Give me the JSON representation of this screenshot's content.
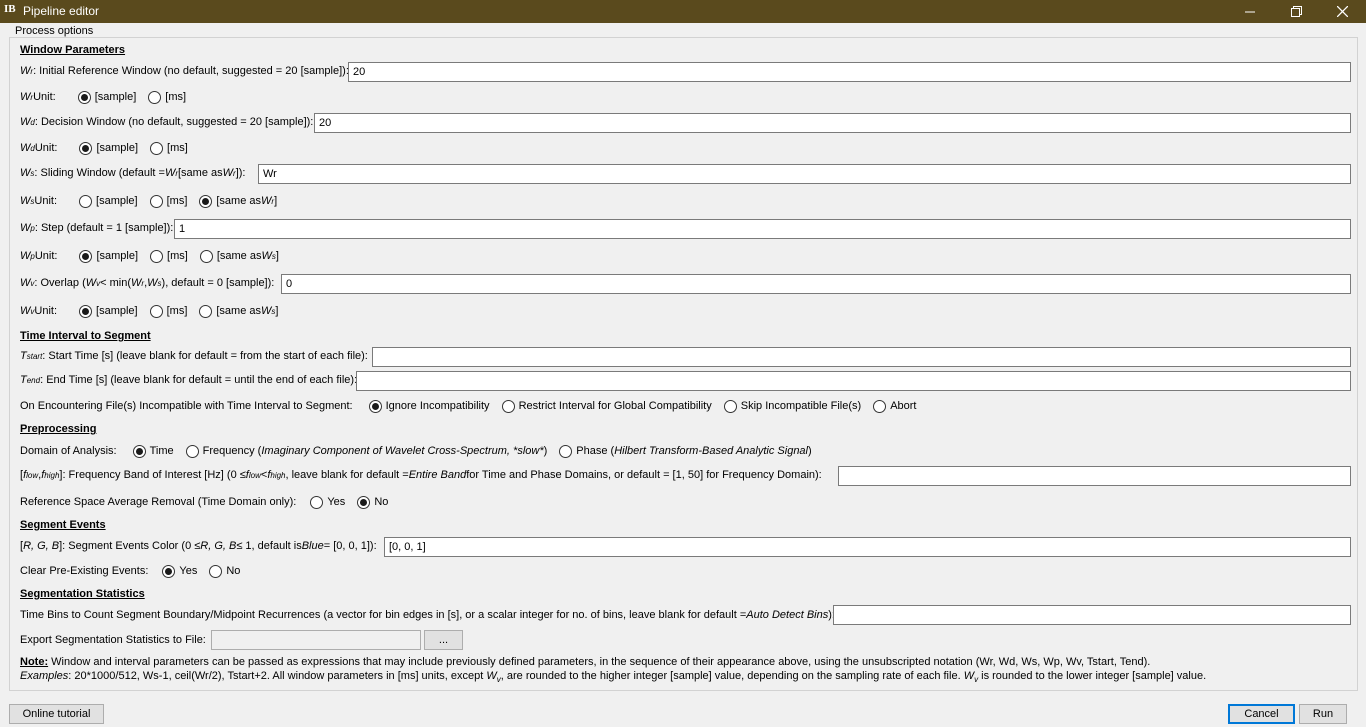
{
  "window": {
    "title": "Pipeline editor",
    "icon": "brainstorm-icon"
  },
  "panel": {
    "title": "Process options"
  },
  "sections": {
    "window_params": "Window Parameters",
    "time_interval": "Time Interval to Segment",
    "preprocessing": "Preprocessing",
    "segment_events": "Segment Events",
    "seg_stats": "Segmentation Statistics"
  },
  "wr": {
    "sym": "W",
    "sub": "r",
    "label": ": Initial Reference Window (no default, suggested = 20 [sample]):",
    "value": "20"
  },
  "wr_unit": {
    "sym": "W",
    "sub": "r",
    "label": " Unit:",
    "options": [
      "[sample]",
      "[ms]"
    ],
    "selected": 0
  },
  "wd": {
    "sym": "W",
    "sub": "d",
    "label": ": Decision Window (no default, suggested = 20 [sample]):",
    "value": "20"
  },
  "wd_unit": {
    "sym": "W",
    "sub": "d",
    "label": " Unit:",
    "options": [
      "[sample]",
      "[ms]"
    ],
    "selected": 0
  },
  "ws": {
    "sym": "W",
    "sub": "s",
    "label_a": ": Sliding Window (default = ",
    "sym2": "W",
    "sub2": "r",
    "label_b": " [same as ",
    "sym3": "W",
    "sub3": "r",
    "label_c": "]):",
    "value": "Wr"
  },
  "ws_unit": {
    "sym": "W",
    "sub": "s",
    "label": " Unit:",
    "options": [
      "[sample]",
      "[ms]"
    ],
    "opt3_a": "[same as ",
    "opt3_sym": "W",
    "opt3_sub": "r",
    "opt3_b": "]",
    "selected": 2
  },
  "wp": {
    "sym": "W",
    "sub": "p",
    "label": ": Step (default = 1 [sample]):",
    "value": "1"
  },
  "wp_unit": {
    "sym": "W",
    "sub": "p",
    "label": " Unit:",
    "options": [
      "[sample]",
      "[ms]"
    ],
    "opt3_a": "[same as ",
    "opt3_sym": "W",
    "opt3_sub": "s",
    "opt3_b": "]",
    "selected": 0
  },
  "wv": {
    "sym": "W",
    "sub": "v",
    "label_a": ": Overlap (",
    "sym2": "W",
    "sub2": "v",
    "label_b": " < min(",
    "sym3": "W",
    "sub3": "r",
    "comma": ",",
    "sym4": "W",
    "sub4": "s",
    "label_c": "), default = 0 [sample]):",
    "value": "0"
  },
  "wv_unit": {
    "sym": "W",
    "sub": "v",
    "label": " Unit:",
    "options": [
      "[sample]",
      "[ms]"
    ],
    "opt3_a": "[same as ",
    "opt3_sym": "W",
    "opt3_sub": "s",
    "opt3_b": "]",
    "selected": 0
  },
  "tstart": {
    "sym": "T",
    "sub": "start",
    "label": ": Start Time [s] (leave blank for default = from the start of each file):",
    "value": ""
  },
  "tend": {
    "sym": "T",
    "sub": "end",
    "label": ": End Time [s] (leave blank for default = until the end of each file):",
    "value": ""
  },
  "incompat": {
    "label": "On Encountering File(s) Incompatible with Time Interval to Segment:",
    "options": [
      "Ignore Incompatibility",
      "Restrict Interval for Global Compatibility",
      "Skip Incompatible File(s)",
      "Abort"
    ],
    "selected": 0
  },
  "domain": {
    "label": "Domain of Analysis:",
    "opt1": "Time",
    "opt2_a": "Frequency (",
    "opt2_i": "Imaginary Component of Wavelet Cross-Spectrum, *slow*",
    "opt2_b": ")",
    "opt3_a": "Phase (",
    "opt3_i": "Hilbert Transform-Based Analytic Signal",
    "opt3_b": ")",
    "selected": 0
  },
  "fband": {
    "p1": "[",
    "f1": "f",
    "s1": "low",
    "p2": ", ",
    "f2": "f",
    "s2": "high",
    "p3": "]: Frequency Band of Interest [Hz] (0 ≤ ",
    "f3": "f",
    "s3": "low",
    "p4": " < ",
    "f4": "f",
    "s4": "high",
    "p5": ", leave blank for default = ",
    "i1": "Entire Band",
    "p6": " for Time and Phase Domains, or default = [1, 50] for Frequency Domain):",
    "value": ""
  },
  "refavg": {
    "label": "Reference Space Average Removal (Time Domain only):",
    "options": [
      "Yes",
      "No"
    ],
    "selected": 1
  },
  "color": {
    "p1": "[",
    "i1": "R, G, B",
    "p2": "]: Segment Events Color (0 ≤ ",
    "i2": "R, G, B",
    "p3": " ≤ 1, default is ",
    "i3": "Blue",
    "p4": " = [0, 0, 1]):",
    "value": "[0, 0, 1]"
  },
  "clear_events": {
    "label": "Clear Pre-Existing Events:",
    "options": [
      "Yes",
      "No"
    ],
    "selected": 0
  },
  "timebins": {
    "label_a": "Time Bins to Count Segment Boundary/Midpoint Recurrences (a vector for bin edges in [s], or a scalar integer for no. of bins, leave blank for default = ",
    "label_i": "Auto Detect Bins",
    "label_b": "):",
    "value": ""
  },
  "export": {
    "label": "Export Segmentation Statistics to File:",
    "value": "",
    "browse": "..."
  },
  "note": {
    "title": "Note:",
    "line1": " Window and interval parameters can be passed as expressions that may include previously defined parameters, in the sequence of their appearance above, using the unsubscripted notation (Wr, Wd, Ws, Wp, Wv, Tstart, Tend).",
    "ex": "Examples",
    "l2a": ": 20*1000/512, Ws-1, ceil(Wr/2), Tstart+2. All window parameters in [ms] units, except ",
    "l2sym": "W",
    "l2sub": "v",
    "l2b": ", are rounded to the higher integer [sample] value, depending on the sampling rate of each file. ",
    "l2sym2": "W",
    "l2sub2": "v",
    "l2c": " is rounded to the lower integer [sample] value."
  },
  "buttons": {
    "tutorial": "Online tutorial",
    "cancel": "Cancel",
    "run": "Run"
  }
}
